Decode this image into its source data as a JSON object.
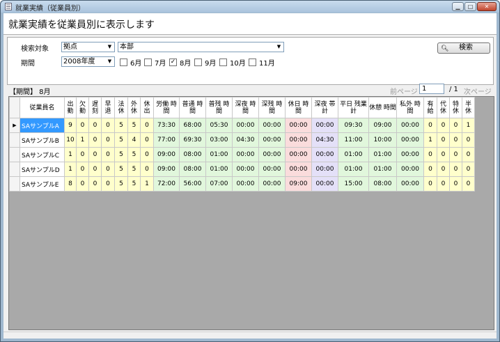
{
  "window": {
    "title": "就業実績（従業員別）"
  },
  "header": {
    "title": "就業実績を従業員別に表示します"
  },
  "search": {
    "target_label": "検索対象",
    "target_type": "拠点",
    "target_value": "本部",
    "period_label": "期間",
    "year": "2008年度",
    "months": [
      {
        "label": "6月",
        "checked": false
      },
      {
        "label": "7月",
        "checked": false
      },
      {
        "label": "8月",
        "checked": true
      },
      {
        "label": "9月",
        "checked": false
      },
      {
        "label": "10月",
        "checked": false
      },
      {
        "label": "11月",
        "checked": false
      }
    ],
    "search_button": "検索"
  },
  "period_info": "【期間】 8月",
  "pager": {
    "prev": "前ページ",
    "current": "1",
    "total": "/ 1",
    "next": "次ページ"
  },
  "grid": {
    "columns": [
      "従業員名",
      "出\n勤",
      "欠\n勤",
      "遅\n刻",
      "早\n退",
      "法\n休",
      "外\n休",
      "休\n出",
      "労働\n時間",
      "普通\n時間",
      "普残\n時間",
      "深夜\n時間",
      "深残\n時間",
      "休日\n時間",
      "深夜\n帯計",
      "平日\n残業計",
      "休憩\n時間",
      "私外\n時間",
      "有\n給",
      "代\n休",
      "特\n休",
      "半\n休"
    ],
    "rows": [
      [
        "SAサンプルA",
        "9",
        "0",
        "0",
        "0",
        "5",
        "5",
        "0",
        "73:30",
        "68:00",
        "05:30",
        "00:00",
        "00:00",
        "00:00",
        "00:00",
        "09:30",
        "09:00",
        "00:00",
        "0",
        "0",
        "0",
        "1"
      ],
      [
        "SAサンプルB",
        "10",
        "1",
        "0",
        "0",
        "5",
        "4",
        "0",
        "77:00",
        "69:30",
        "03:00",
        "04:30",
        "00:00",
        "00:00",
        "04:30",
        "11:00",
        "10:00",
        "00:00",
        "1",
        "0",
        "0",
        "0"
      ],
      [
        "SAサンプルC",
        "1",
        "0",
        "0",
        "0",
        "5",
        "5",
        "0",
        "09:00",
        "08:00",
        "01:00",
        "00:00",
        "00:00",
        "00:00",
        "00:00",
        "01:00",
        "01:00",
        "00:00",
        "0",
        "0",
        "0",
        "0"
      ],
      [
        "SAサンプルD",
        "1",
        "0",
        "0",
        "0",
        "5",
        "5",
        "0",
        "09:00",
        "08:00",
        "01:00",
        "00:00",
        "00:00",
        "00:00",
        "00:00",
        "01:00",
        "01:00",
        "00:00",
        "0",
        "0",
        "0",
        "0"
      ],
      [
        "SAサンプルE",
        "8",
        "0",
        "0",
        "0",
        "5",
        "5",
        "1",
        "72:00",
        "56:00",
        "07:00",
        "00:00",
        "00:00",
        "09:00",
        "00:00",
        "15:00",
        "08:00",
        "00:00",
        "0",
        "0",
        "0",
        "0"
      ]
    ],
    "colors": {
      "yellow": "#ffffcc",
      "green": "#e1f7dc",
      "pink": "#fadcdc",
      "lavender": "#e4e0f8",
      "selected": "#3399ff"
    }
  }
}
